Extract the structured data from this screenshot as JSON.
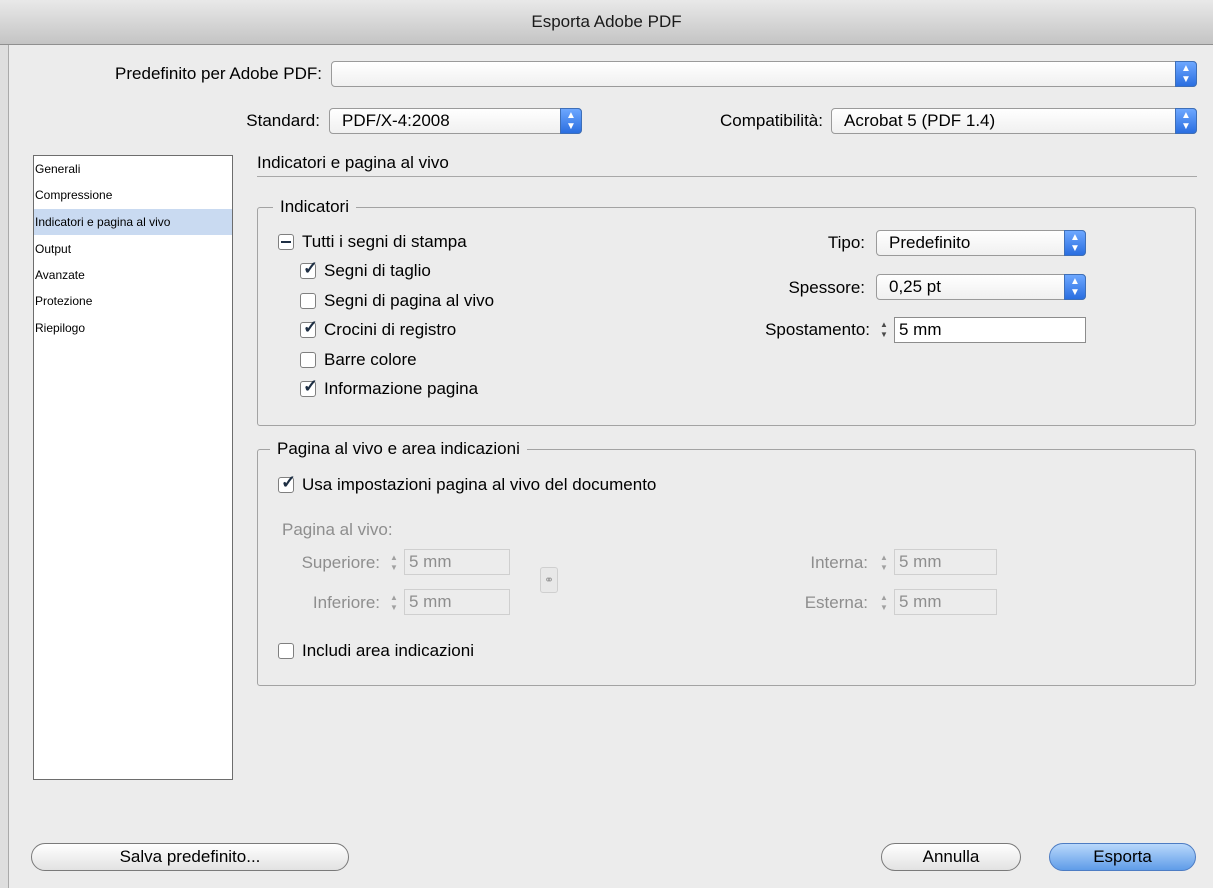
{
  "window": {
    "title": "Esporta Adobe PDF"
  },
  "header": {
    "preset_label": "Predefinito per Adobe PDF:",
    "preset_value": "",
    "standard_label": "Standard:",
    "standard_value": "PDF/X-4:2008",
    "compat_label": "Compatibilità:",
    "compat_value": "Acrobat 5 (PDF 1.4)"
  },
  "sidebar": {
    "items": [
      {
        "label": "Generali"
      },
      {
        "label": "Compressione"
      },
      {
        "label": "Indicatori e pagina al vivo"
      },
      {
        "label": "Output"
      },
      {
        "label": "Avanzate"
      },
      {
        "label": "Protezione"
      },
      {
        "label": "Riepilogo"
      }
    ],
    "selected": "Indicatori e pagina al vivo"
  },
  "panel": {
    "title": "Indicatori e pagina al vivo",
    "marks": {
      "legend": "Indicatori",
      "all_marks": "Tutti i segni di stampa",
      "crop_marks": "Segni di taglio",
      "bleed_marks": "Segni di pagina al vivo",
      "registration_marks": "Crocini di registro",
      "color_bars": "Barre colore",
      "page_info": "Informazione pagina",
      "type_label": "Tipo:",
      "type_value": "Predefinito",
      "weight_label": "Spessore:",
      "weight_value": "0,25 pt",
      "offset_label": "Spostamento:",
      "offset_value": "5 mm"
    },
    "bleed": {
      "legend": "Pagina al vivo e area indicazioni",
      "use_doc_bleed": "Usa impostazioni pagina al vivo del documento",
      "bleed_label": "Pagina al vivo:",
      "top_label": "Superiore:",
      "top_value": "5 mm",
      "bottom_label": "Inferiore:",
      "bottom_value": "5 mm",
      "inside_label": "Interna:",
      "inside_value": "5 mm",
      "outside_label": "Esterna:",
      "outside_value": "5 mm",
      "include_slug": "Includi area indicazioni"
    }
  },
  "footer": {
    "save_preset": "Salva predefinito...",
    "cancel": "Annulla",
    "export": "Esporta"
  }
}
